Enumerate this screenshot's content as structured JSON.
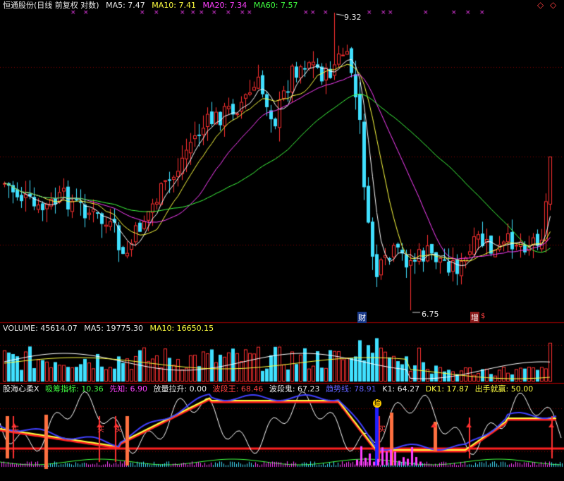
{
  "main": {
    "title": "恒通股份(日线 前复权 对数)",
    "ma5": "MA5: 7.47",
    "ma10": "MA10: 7.41",
    "ma20": "MA20: 7.34",
    "ma60": "MA60: 7.57",
    "high_label": "9.32",
    "low_label": "6.75",
    "tag_cai": "财",
    "tag_zeng": "增",
    "tag_s": "$"
  },
  "volume": {
    "title": "VOLUME: 45614.07",
    "ma5": "MA5: 19775.30",
    "ma10": "MA10: 16650.15"
  },
  "indicator": {
    "title": "股海心柔X",
    "xichou": "吸筹指标: 10.36",
    "xianzhi": "先知: 6.90",
    "fangliang": "放量拉升: 0.00",
    "boduanwang": "波段王: 68.46",
    "boduangui": "波段鬼: 67.23",
    "qushixian": "趋势线: 78.91",
    "k1": "K1: 64.27",
    "dk1": "DK1: 17.87",
    "chushou": "出手就赢: 50.00",
    "buy": "买",
    "shi": "拾"
  },
  "colors": {
    "up": "#ff3030",
    "down": "#40e0ff",
    "ma5": "#ffffff",
    "ma10": "#ffff40",
    "ma20": "#ff40ff",
    "ma60": "#40ff40",
    "grid": "#8b0000"
  },
  "chart_data": {
    "type": "candlestick",
    "series_closes": [
      6.95,
      7.05,
      7.1,
      6.9,
      6.85,
      7.0,
      7.15,
      7.3,
      7.2,
      7.1,
      7.25,
      7.05,
      6.95,
      7.0,
      7.2,
      7.1,
      6.9,
      6.8,
      6.7,
      6.75,
      6.9,
      7.0,
      7.2,
      7.35,
      7.5,
      7.65,
      7.8,
      7.95,
      8.1,
      8.3,
      8.5,
      8.6,
      8.45,
      8.7,
      8.9,
      8.75,
      8.6,
      8.8,
      8.95,
      9.0,
      8.85,
      8.7,
      8.9,
      9.1,
      9.2,
      9.05,
      8.85,
      8.6,
      8.4,
      8.2,
      7.8,
      7.4,
      7.1,
      6.9,
      7.05,
      7.2,
      7.1,
      7.0,
      6.9,
      7.1,
      7.0,
      6.95,
      6.9,
      7.05,
      7.0,
      6.95,
      7.0,
      7.1,
      7.15,
      7.2,
      7.3,
      7.25,
      7.2,
      7.3,
      7.35,
      7.4,
      7.45,
      7.4,
      7.47,
      7.9
    ],
    "high": 9.32,
    "low": 6.75
  }
}
